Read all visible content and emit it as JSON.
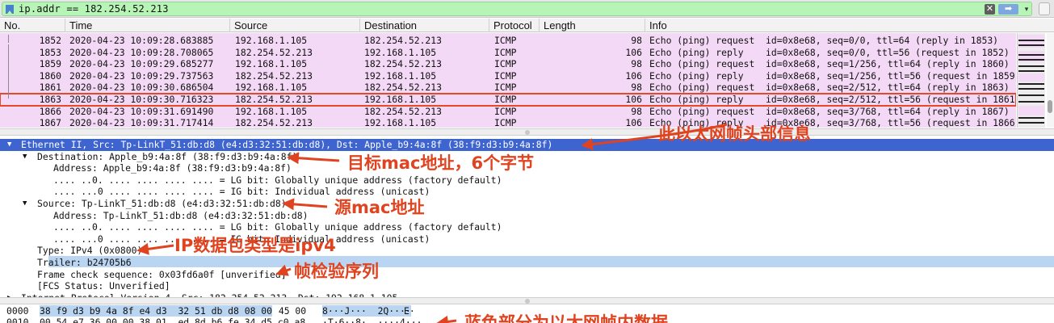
{
  "filter": {
    "value": "ip.addr == 182.254.52.213",
    "clear_glyph": "✕",
    "apply_glyph": "➡",
    "history_glyph": "▾"
  },
  "columns": [
    "No.",
    "Time",
    "Source",
    "Destination",
    "Protocol",
    "Length",
    "Info"
  ],
  "packets": [
    {
      "no": "1852",
      "time": "2020-04-23 10:09:28.683885",
      "src": "192.168.1.105",
      "dst": "182.254.52.213",
      "proto": "ICMP",
      "len": "98",
      "info": "Echo (ping) request  id=0x8e68, seq=0/0, ttl=64 (reply in 1853)"
    },
    {
      "no": "1853",
      "time": "2020-04-23 10:09:28.708065",
      "src": "182.254.52.213",
      "dst": "192.168.1.105",
      "proto": "ICMP",
      "len": "106",
      "info": "Echo (ping) reply    id=0x8e68, seq=0/0, ttl=56 (request in 1852)"
    },
    {
      "no": "1859",
      "time": "2020-04-23 10:09:29.685277",
      "src": "192.168.1.105",
      "dst": "182.254.52.213",
      "proto": "ICMP",
      "len": "98",
      "info": "Echo (ping) request  id=0x8e68, seq=1/256, ttl=64 (reply in 1860)"
    },
    {
      "no": "1860",
      "time": "2020-04-23 10:09:29.737563",
      "src": "182.254.52.213",
      "dst": "192.168.1.105",
      "proto": "ICMP",
      "len": "106",
      "info": "Echo (ping) reply    id=0x8e68, seq=1/256, ttl=56 (request in 1859)"
    },
    {
      "no": "1861",
      "time": "2020-04-23 10:09:30.686504",
      "src": "192.168.1.105",
      "dst": "182.254.52.213",
      "proto": "ICMP",
      "len": "98",
      "info": "Echo (ping) request  id=0x8e68, seq=2/512, ttl=64 (reply in 1863)"
    },
    {
      "no": "1863",
      "time": "2020-04-23 10:09:30.716323",
      "src": "182.254.52.213",
      "dst": "192.168.1.105",
      "proto": "ICMP",
      "len": "106",
      "info": "Echo (ping) reply    id=0x8e68, seq=2/512, ttl=56 (request in 1861)"
    },
    {
      "no": "1866",
      "time": "2020-04-23 10:09:31.691490",
      "src": "192.168.1.105",
      "dst": "182.254.52.213",
      "proto": "ICMP",
      "len": "98",
      "info": "Echo (ping) request  id=0x8e68, seq=3/768, ttl=64 (reply in 1867)"
    },
    {
      "no": "1867",
      "time": "2020-04-23 10:09:31.717414",
      "src": "182.254.52.213",
      "dst": "192.168.1.105",
      "proto": "ICMP",
      "len": "106",
      "info": "Echo (ping) reply    id=0x8e68, seq=3/768, ttl=56 (request in 1866)"
    }
  ],
  "details": [
    "Ethernet II, Src: Tp-LinkT_51:db:d8 (e4:d3:32:51:db:d8), Dst: Apple_b9:4a:8f (38:f9:d3:b9:4a:8f)",
    "Destination: Apple_b9:4a:8f (38:f9:d3:b9:4a:8f)",
    "Address: Apple_b9:4a:8f (38:f9:d3:b9:4a:8f)",
    ".... ..0. .... .... .... .... = LG bit: Globally unique address (factory default)",
    ".... ...0 .... .... .... .... = IG bit: Individual address (unicast)",
    "Source: Tp-LinkT_51:db:d8 (e4:d3:32:51:db:d8)",
    "Address: Tp-LinkT_51:db:d8 (e4:d3:32:51:db:d8)",
    ".... ..0. .... .... .... .... = LG bit: Globally unique address (factory default)",
    ".... ...0 .... .... .... .... = IG bit: Individual address (unicast)",
    "Type: IPv4 (0x0800)",
    "Trailer: b24705b6",
    "Frame check sequence: 0x03fd6a0f [unverified]",
    "[FCS Status: Unverified]",
    "Internet Protocol Version 4, Src: 182.254.52.213, Dst: 192.168.1.105"
  ],
  "bytes": [
    {
      "offset": "0000",
      "hex_hl": "38 f9 d3 b9 4a 8f e4 d3  32 51 db d8 08 00",
      "hex_rest": " 45 00",
      "ascii_hl": "8···J···  2Q····",
      "ascii_rest": "E·"
    },
    {
      "offset": "0010",
      "hex_hl": "",
      "hex_rest": "00 54 e7 36 00 00 38 01  ed 8d b6 fe 34 d5 c0 a8",
      "ascii_hl": "",
      "ascii_rest": "·T·6··8·  ····4···"
    }
  ],
  "annotations": {
    "eth_header": "此以太网帧头部信息",
    "dst_mac": "目标mac地址，6个字节",
    "src_mac": "源mac地址",
    "ip_type": "IP数据包类型是ipv4",
    "fcs": "帧检验序列",
    "blue_data": "蓝色部分为以太网帧内数据"
  },
  "colors": {
    "filter_bg": "#b7f5b7",
    "row_bg": "#f4d9f6",
    "selected_row_bg": "#3e64cf",
    "highlight_bg": "#b9d5f2",
    "annotation": "#e0431f"
  }
}
